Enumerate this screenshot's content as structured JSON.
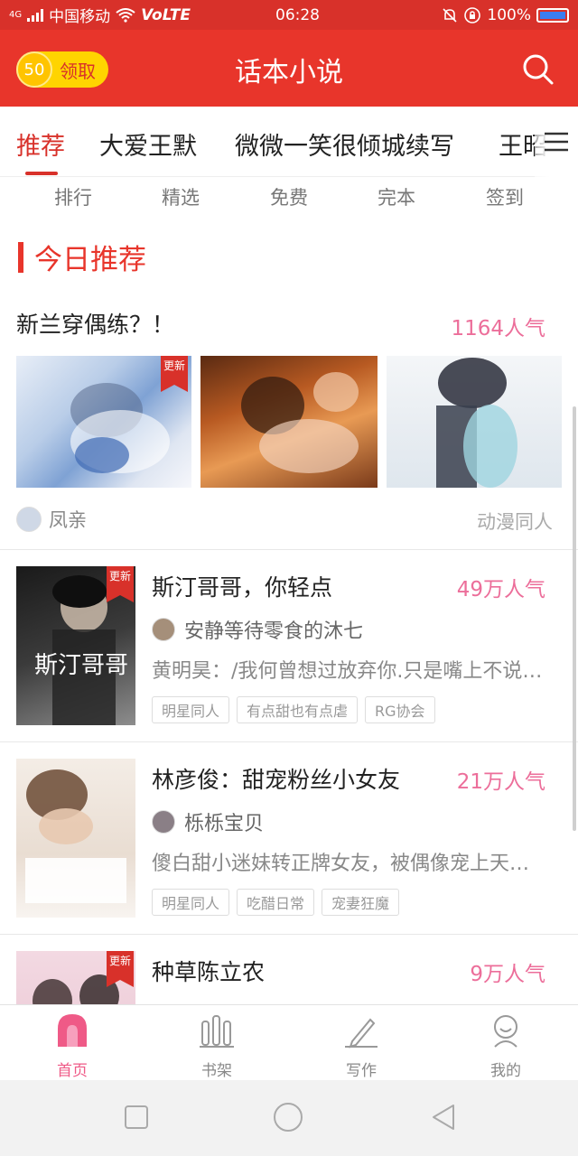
{
  "status_bar": {
    "network": "4G",
    "carrier": "中国移动",
    "volte": "VoLTE",
    "time": "06:28",
    "battery": "100%"
  },
  "app_bar": {
    "coin_value": "50",
    "coin_label": "领取",
    "title": "话本小说",
    "icons": {
      "search": "search-icon"
    }
  },
  "tabs": {
    "items": [
      {
        "label": "推荐",
        "active": true
      },
      {
        "label": "大爱王默",
        "active": false
      },
      {
        "label": "微微一笑很倾城续写",
        "active": false
      },
      {
        "label": "王昭",
        "active": false
      }
    ],
    "menu_icon": "menu-icon"
  },
  "quick_links": [
    "排行",
    "精选",
    "免费",
    "完本",
    "签到"
  ],
  "section": {
    "title": "今日推荐"
  },
  "featured": {
    "title": "新兰穿偶练？！",
    "popularity": "1164人气",
    "badge": "更新",
    "author": "凤亲",
    "genre": "动漫同人"
  },
  "books": [
    {
      "title": "斯汀哥哥，你轻点",
      "popularity": "49万人气",
      "author": "安静等待零食的沐七",
      "description": "黄明昊：/我何曾想过放弃你.只是嘴上不说而已",
      "tags": [
        "明星同人",
        "有点甜也有点虐",
        "RG协会"
      ],
      "badge": "更新",
      "cover_text": "斯汀哥哥 你轻点"
    },
    {
      "title": "林彦俊：甜宠粉丝小女友",
      "popularity": "21万人气",
      "author": "栎栎宝贝",
      "description": "傻白甜小迷妹转正牌女友，被偶像宠上天的故事",
      "tags": [
        "明星同人",
        "吃醋日常",
        "宠妻狂魔"
      ],
      "badge": ""
    },
    {
      "title": "种草陈立农",
      "popularity": "9万人气",
      "author": "",
      "description": "",
      "tags": [],
      "badge": "更新"
    }
  ],
  "bottom_nav": [
    {
      "label": "首页",
      "icon": "home-icon",
      "active": true
    },
    {
      "label": "书架",
      "icon": "bookshelf-icon",
      "active": false
    },
    {
      "label": "写作",
      "icon": "pen-icon",
      "active": false
    },
    {
      "label": "我的",
      "icon": "profile-icon",
      "active": false
    }
  ],
  "colors": {
    "brand_red": "#e8352b",
    "popularity_pink": "#ec6e9a",
    "coin_yellow": "#ffd400"
  }
}
